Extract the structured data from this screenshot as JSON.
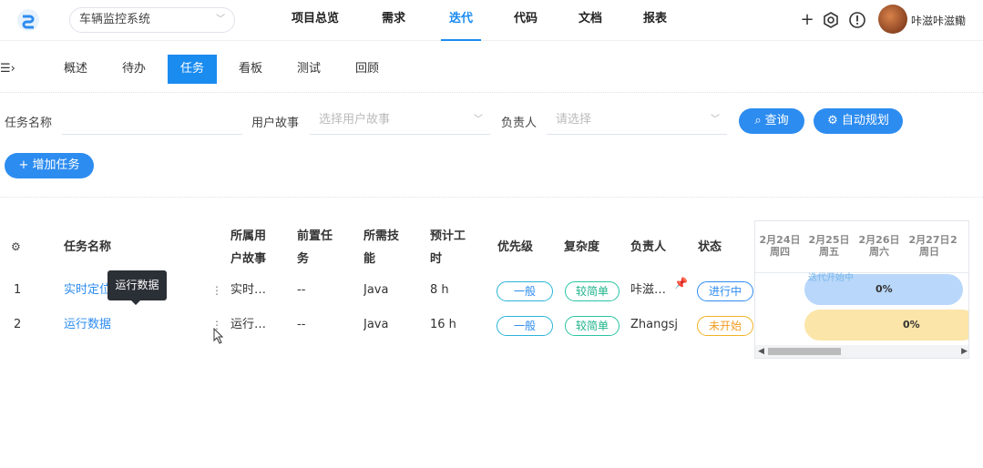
{
  "header": {
    "project_name": "车辆监控系统",
    "nav": [
      "项目总览",
      "需求",
      "迭代",
      "代码",
      "文档",
      "报表"
    ],
    "active_nav": "迭代",
    "username": "咔滋咔滋鳓"
  },
  "subtabs": {
    "items": [
      "概述",
      "待办",
      "任务",
      "看板",
      "测试",
      "回顾"
    ],
    "active": "任务"
  },
  "filters": {
    "task_name_label": "任务名称",
    "task_name_value": "",
    "story_label": "用户故事",
    "story_placeholder": "选择用户故事",
    "owner_label": "负责人",
    "owner_placeholder": "请选择",
    "query_button": "查询",
    "auto_plan_button": "自动规划"
  },
  "add_task_button": "增加任务",
  "table": {
    "headers": {
      "name": "任务名称",
      "story_1": "所属用",
      "story_2": "户故事",
      "pre_1": "前置任",
      "pre_2": "务",
      "skill_1": "所需技",
      "skill_2": "能",
      "hours_1": "预计工",
      "hours_2": "时",
      "priority": "优先级",
      "complexity": "复杂度",
      "owner": "负责人",
      "status": "状态"
    },
    "rows": [
      {
        "index": "1",
        "name": "实时定位",
        "story": "实时…",
        "pre": "--",
        "skill": "Java",
        "hours": "8 h",
        "priority": "一般",
        "complexity": "较简单",
        "owner": "咔滋…",
        "status": "进行中"
      },
      {
        "index": "2",
        "name": "运行数据",
        "story": "运行…",
        "pre": "--",
        "skill": "Java",
        "hours": "16 h",
        "priority": "一般",
        "complexity": "较简单",
        "owner": "Zhangsj",
        "status": "未开始"
      }
    ]
  },
  "tooltip": "运行数据",
  "gantt": {
    "days": [
      {
        "date": "2月24日",
        "weekday": "周四"
      },
      {
        "date": "2月25日",
        "weekday": "周五"
      },
      {
        "date": "2月26日",
        "weekday": "周六"
      },
      {
        "date": "2月27日",
        "weekday": "周日"
      },
      {
        "date": "2",
        "weekday": ""
      }
    ],
    "bars": [
      {
        "label": "迭代开始中",
        "percent": "0%",
        "progress": 0,
        "color": "#b9d7fa"
      },
      {
        "label": "",
        "percent": "0%",
        "progress": 0,
        "color": "#fbe5a8"
      }
    ]
  },
  "colors": {
    "accent": "#1a8cf0",
    "button": "#2d8cf0"
  },
  "icons": [
    "logo-icon",
    "plus-icon",
    "settings-icon",
    "alert-icon",
    "search-icon",
    "gear-icon",
    "pin-icon",
    "menu-collapse-icon"
  ]
}
